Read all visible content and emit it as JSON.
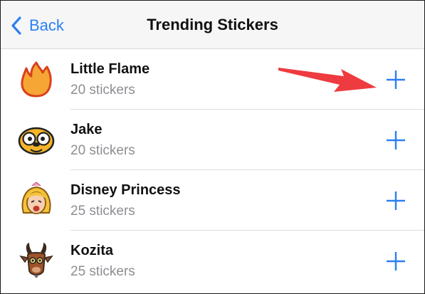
{
  "colors": {
    "accent": "#2b7ff2",
    "arrow": "#ee3b3f"
  },
  "nav": {
    "back_label": "Back",
    "title": "Trending Stickers",
    "back_icon": "chevron-left-icon"
  },
  "sticker_packs": [
    {
      "name": "Little Flame",
      "count": "20 stickers",
      "icon": "flame-sticker-icon"
    },
    {
      "name": "Jake",
      "count": "20 stickers",
      "icon": "jake-dog-sticker-icon"
    },
    {
      "name": "Disney Princess",
      "count": "25 stickers",
      "icon": "princess-sticker-icon"
    },
    {
      "name": "Kozita",
      "count": "25 stickers",
      "icon": "goat-sticker-icon"
    }
  ],
  "add_icon": "plus-icon",
  "annotation": {
    "icon": "red-arrow-icon"
  }
}
